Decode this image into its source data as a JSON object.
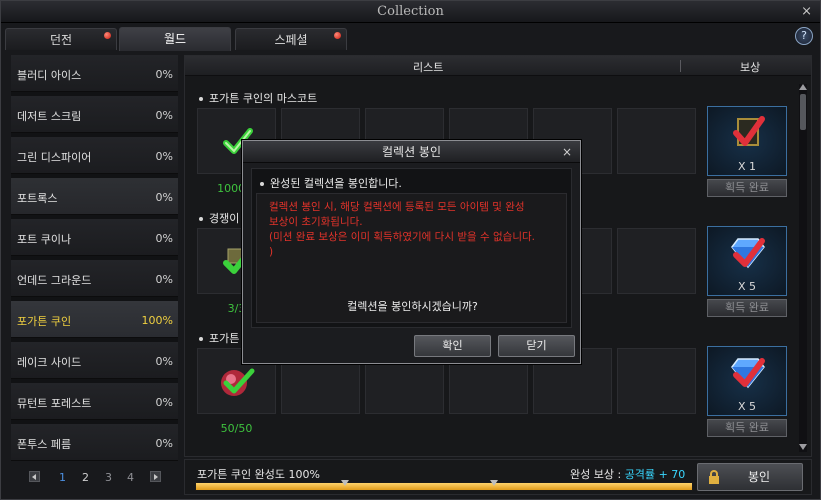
{
  "window": {
    "title": "Collection",
    "close_glyph": "×"
  },
  "tabs": [
    {
      "label": "던전",
      "has_alert": true
    },
    {
      "label": "월드",
      "has_alert": false,
      "active": true
    },
    {
      "label": "스페셜",
      "has_alert": true
    }
  ],
  "help": {
    "glyph": "?"
  },
  "sidebar": {
    "items": [
      {
        "label": "블러디 아이스",
        "percent": "0%"
      },
      {
        "label": "데저트 스크림",
        "percent": "0%"
      },
      {
        "label": "그린 디스파이어",
        "percent": "0%"
      },
      {
        "label": "포트록스",
        "percent": "0%"
      },
      {
        "label": "포트 쿠이나",
        "percent": "0%"
      },
      {
        "label": "언데드 그라운드",
        "percent": "0%"
      },
      {
        "label": "포가튼 쿠인",
        "percent": "100%"
      },
      {
        "label": "레이크 사이드",
        "percent": "0%"
      },
      {
        "label": "뮤턴트 포레스트",
        "percent": "0%"
      },
      {
        "label": "폰투스 페름",
        "percent": "0%"
      }
    ]
  },
  "pager": {
    "pages": [
      "1",
      "2",
      "3",
      "4"
    ],
    "current": "1"
  },
  "list": {
    "header_list": "리스트",
    "header_reward": "보상",
    "groups": [
      {
        "title": "포가튼 쿠인의 마스코트",
        "progress": "1000/1",
        "reward_count": "X 1",
        "reward_button": "획득 완료"
      },
      {
        "title": "경쟁이",
        "progress": "3/3",
        "reward_count": "X 5",
        "reward_button": "획득 완료"
      },
      {
        "title": "포가튼",
        "progress": "50/50",
        "reward_count": "X 5",
        "reward_button": "획득 완료"
      }
    ]
  },
  "bottom": {
    "completion_text": "포가튼 쿠인 완성도 100%",
    "reward_prefix": "완성 보상 : ",
    "reward_stat": "공격률",
    "reward_value": "+ 70",
    "progress_fraction": 1.0,
    "seal_button": "봉인"
  },
  "dialog": {
    "title": "컬렉션 봉인",
    "close_glyph": "×",
    "subtitle": "완성된 컬렉션을 봉인합니다.",
    "warning_line1": "컬렉션 봉인 시, 해당 컬렉션에 등록된 모든 아이템 및 완성",
    "warning_line2": "보상이 초기화됩니다.",
    "warning_line3": "(미션 완료 보상은 이미 획득하였기에 다시 받을 수 없습니다.",
    "warning_line4": ")",
    "question": "컬렉션을 봉인하시겠습니까?",
    "confirm_button": "확인",
    "close_button": "닫기"
  },
  "colors": {
    "accent_gold": "#f0d040",
    "progress_green": "#3ec23e",
    "warning_red": "#e3332a",
    "stat_cyan": "#39d7ff"
  }
}
